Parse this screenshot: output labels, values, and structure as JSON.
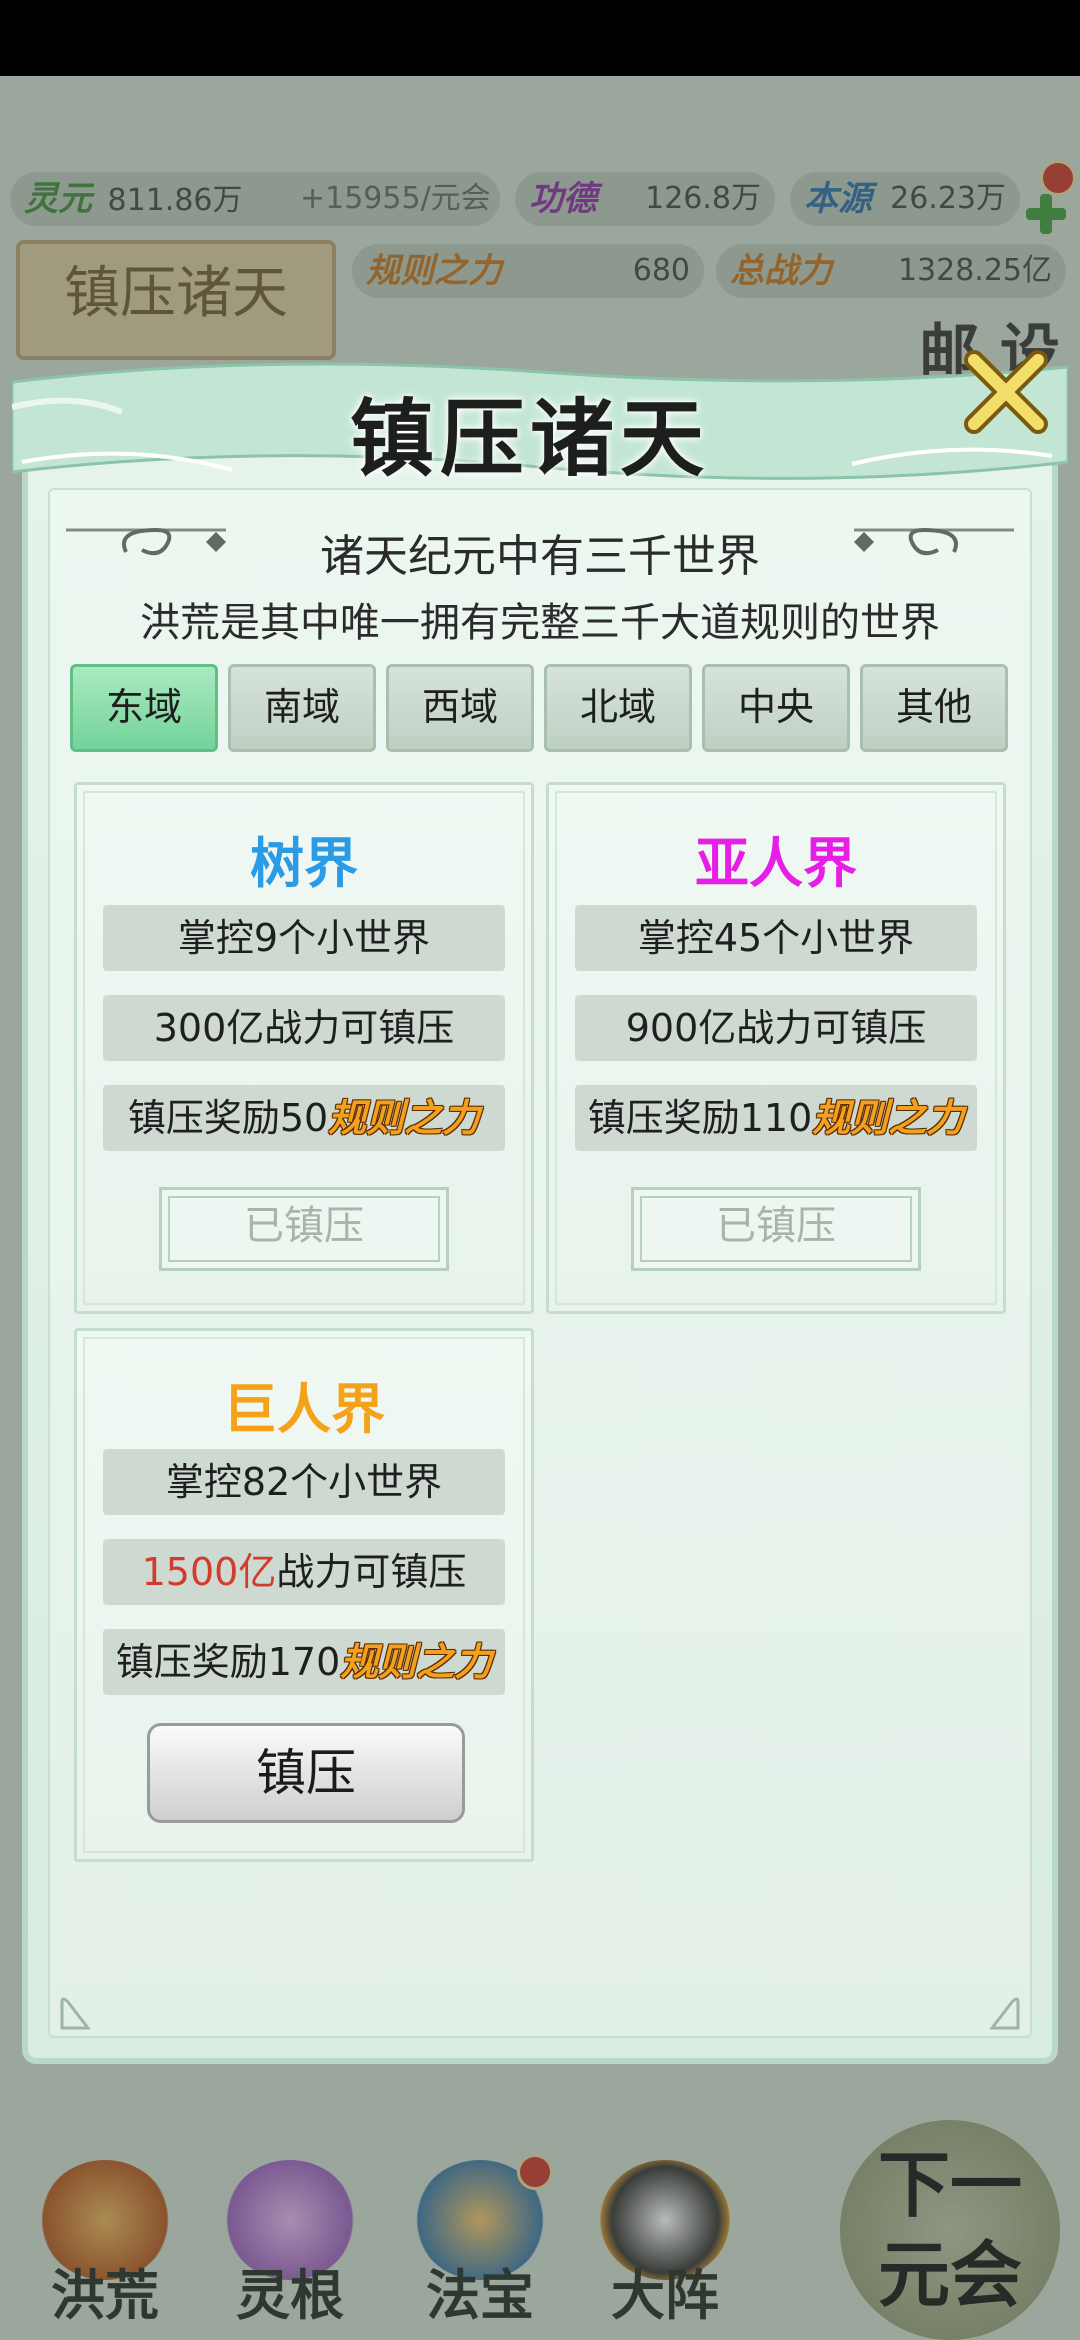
{
  "hud": {
    "lingyuan": {
      "label": "灵元",
      "value": "811.86万",
      "rate": "+15955/元会"
    },
    "gongde": {
      "label": "功德",
      "value": "126.8万"
    },
    "benyuan": {
      "label": "本源",
      "value": "26.23万"
    },
    "guize": {
      "label": "规则之力",
      "value": "680"
    },
    "zongzhanli": {
      "label": "总战力",
      "value": "1328.25亿"
    },
    "side_plaque": "镇压诸天",
    "corner_icons": "邮 设"
  },
  "bottom_nav": {
    "items": [
      {
        "label": "洪荒"
      },
      {
        "label": "灵根"
      },
      {
        "label": "法宝"
      },
      {
        "label": "大阵"
      }
    ],
    "next_era": [
      "下一",
      "元会"
    ]
  },
  "modal": {
    "title": "镇压诸天",
    "headline": "诸天纪元中有三千世界",
    "subline": "洪荒是其中唯一拥有完整三千大道规则的世界",
    "tabs": [
      {
        "label": "东域",
        "active": true
      },
      {
        "label": "南域",
        "active": false
      },
      {
        "label": "西域",
        "active": false
      },
      {
        "label": "北域",
        "active": false
      },
      {
        "label": "中央",
        "active": false
      },
      {
        "label": "其他",
        "active": false
      }
    ],
    "worlds": [
      {
        "name": "树界",
        "color": "#2b9be6",
        "control": "掌控9个小世界",
        "power": "300亿",
        "power_suffix": "战力可镇压",
        "reward_prefix": "镇压奖励50",
        "reward_word": "规则之力",
        "action": "已镇压"
      },
      {
        "name": "亚人界",
        "color": "#e61ee6",
        "control": "掌控45个小世界",
        "power": "900亿",
        "power_suffix": "战力可镇压",
        "reward_prefix": "镇压奖励110",
        "reward_word": "规则之力",
        "action": "已镇压"
      },
      {
        "name": "巨人界",
        "color": "#f5a21b",
        "control": "掌控82个小世界",
        "power": "1500亿",
        "power_suffix": "战力可镇压",
        "reward_prefix": "镇压奖励170",
        "reward_word": "规则之力",
        "action": "镇压"
      }
    ]
  }
}
